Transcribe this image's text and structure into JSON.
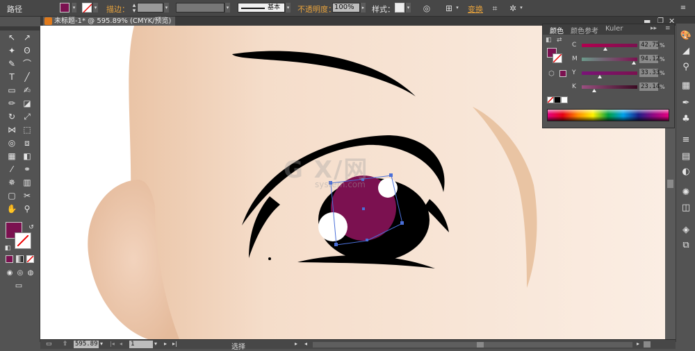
{
  "control_bar": {
    "object_type": "路径",
    "stroke_label": "描边：",
    "stroke_profile": "基本",
    "opacity_label": "不透明度：",
    "opacity_value": "100%",
    "style_label": "样式：",
    "transform_label": "变换",
    "fill_color": "#7b1150"
  },
  "document_tab": {
    "title": "未标题-1* @ 595.89% (CMYK/预览)"
  },
  "tools": {
    "fill_color": "#7b1150",
    "icons": [
      "selection-icon",
      "direct-selection-icon",
      "magic-wand-icon",
      "lasso-icon",
      "pen-icon",
      "curvature-icon",
      "type-icon",
      "line-icon",
      "rectangle-icon",
      "paintbrush-icon",
      "pencil-icon",
      "eraser-icon",
      "rotate-icon",
      "scale-icon",
      "width-icon",
      "free-transform-icon",
      "shape-builder-icon",
      "perspective-icon",
      "mesh-icon",
      "gradient-icon",
      "eyedropper-icon",
      "blend-icon",
      "symbol-sprayer-icon",
      "column-graph-icon",
      "artboard-icon",
      "slice-icon",
      "hand-icon",
      "zoom-icon"
    ]
  },
  "color_panel": {
    "tabs": [
      "颜色",
      "颜色参考",
      "Kuler"
    ],
    "active_tab": "颜色",
    "swatch_color": "#7b1150",
    "sliders": [
      {
        "label": "C",
        "value": "42.75",
        "fraction": 0.43,
        "gradient": [
          "#b2004f",
          "#7b1150"
        ]
      },
      {
        "label": "M",
        "value": "94.12",
        "fraction": 0.94,
        "gradient": [
          "#6b9a8a",
          "#7b1150"
        ]
      },
      {
        "label": "Y",
        "value": "33.33",
        "fraction": 0.33,
        "gradient": [
          "#7a1378",
          "#7b1150"
        ]
      },
      {
        "label": "K",
        "value": "23.14",
        "fraction": 0.23,
        "gradient": [
          "#9a5080",
          "#3a0a22"
        ]
      }
    ],
    "percent_sign": "%"
  },
  "status_bar": {
    "zoom": "595.89",
    "artboard": "1",
    "tool_name": "选择"
  },
  "watermark": {
    "brand": "G X/网",
    "domain": "system.com"
  },
  "canvas": {
    "skin_color": "#f6dcc8",
    "iris_color": "#7b1150"
  }
}
